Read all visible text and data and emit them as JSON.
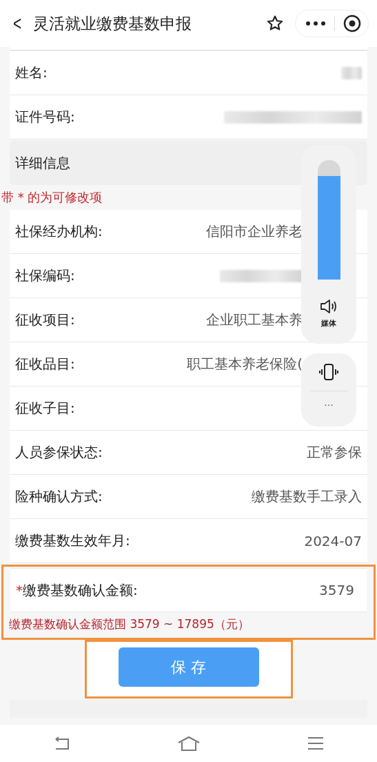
{
  "header": {
    "back": "<",
    "title": "灵活就业缴费基数申报"
  },
  "basic_rows": [
    {
      "label": "姓名:",
      "redacted": true
    },
    {
      "label": "证件号码:",
      "redacted": true
    }
  ],
  "section_title": "详细信息",
  "note": "带 * 的为可修改项",
  "detail_rows": [
    {
      "kind": "text",
      "label": "社保经办机构:",
      "value": "信阳市企业养老",
      "obscured": true
    },
    {
      "kind": "blurred",
      "label": "社保编码:",
      "obscured": true
    },
    {
      "kind": "text",
      "label": "征收项目:",
      "value": "企业职工基本养",
      "obscured": true
    },
    {
      "kind": "text",
      "label": "征收品目:",
      "value": "职工基本养老保险(",
      "obscured": true
    },
    {
      "kind": "text",
      "label": "征收子目:"
    },
    {
      "kind": "text",
      "label": "人员参保状态:",
      "value": "正常参保"
    },
    {
      "kind": "text",
      "label": "险种确认方式:",
      "value": "缴费基数手工录入"
    },
    {
      "kind": "text",
      "label": "缴费基数生效年月:",
      "value": "2024-07"
    }
  ],
  "amount": {
    "required_mark": "*",
    "label": "缴费基数确认金额:",
    "value": "3579",
    "range_note": "缴费基数确认金额范围 3579 ~ 17895（元）",
    "highlighted": true
  },
  "save_button": {
    "label": "保 存",
    "highlighted": true
  },
  "volume_panel": {
    "level": 0.87,
    "label": "媒体",
    "more": "···"
  }
}
